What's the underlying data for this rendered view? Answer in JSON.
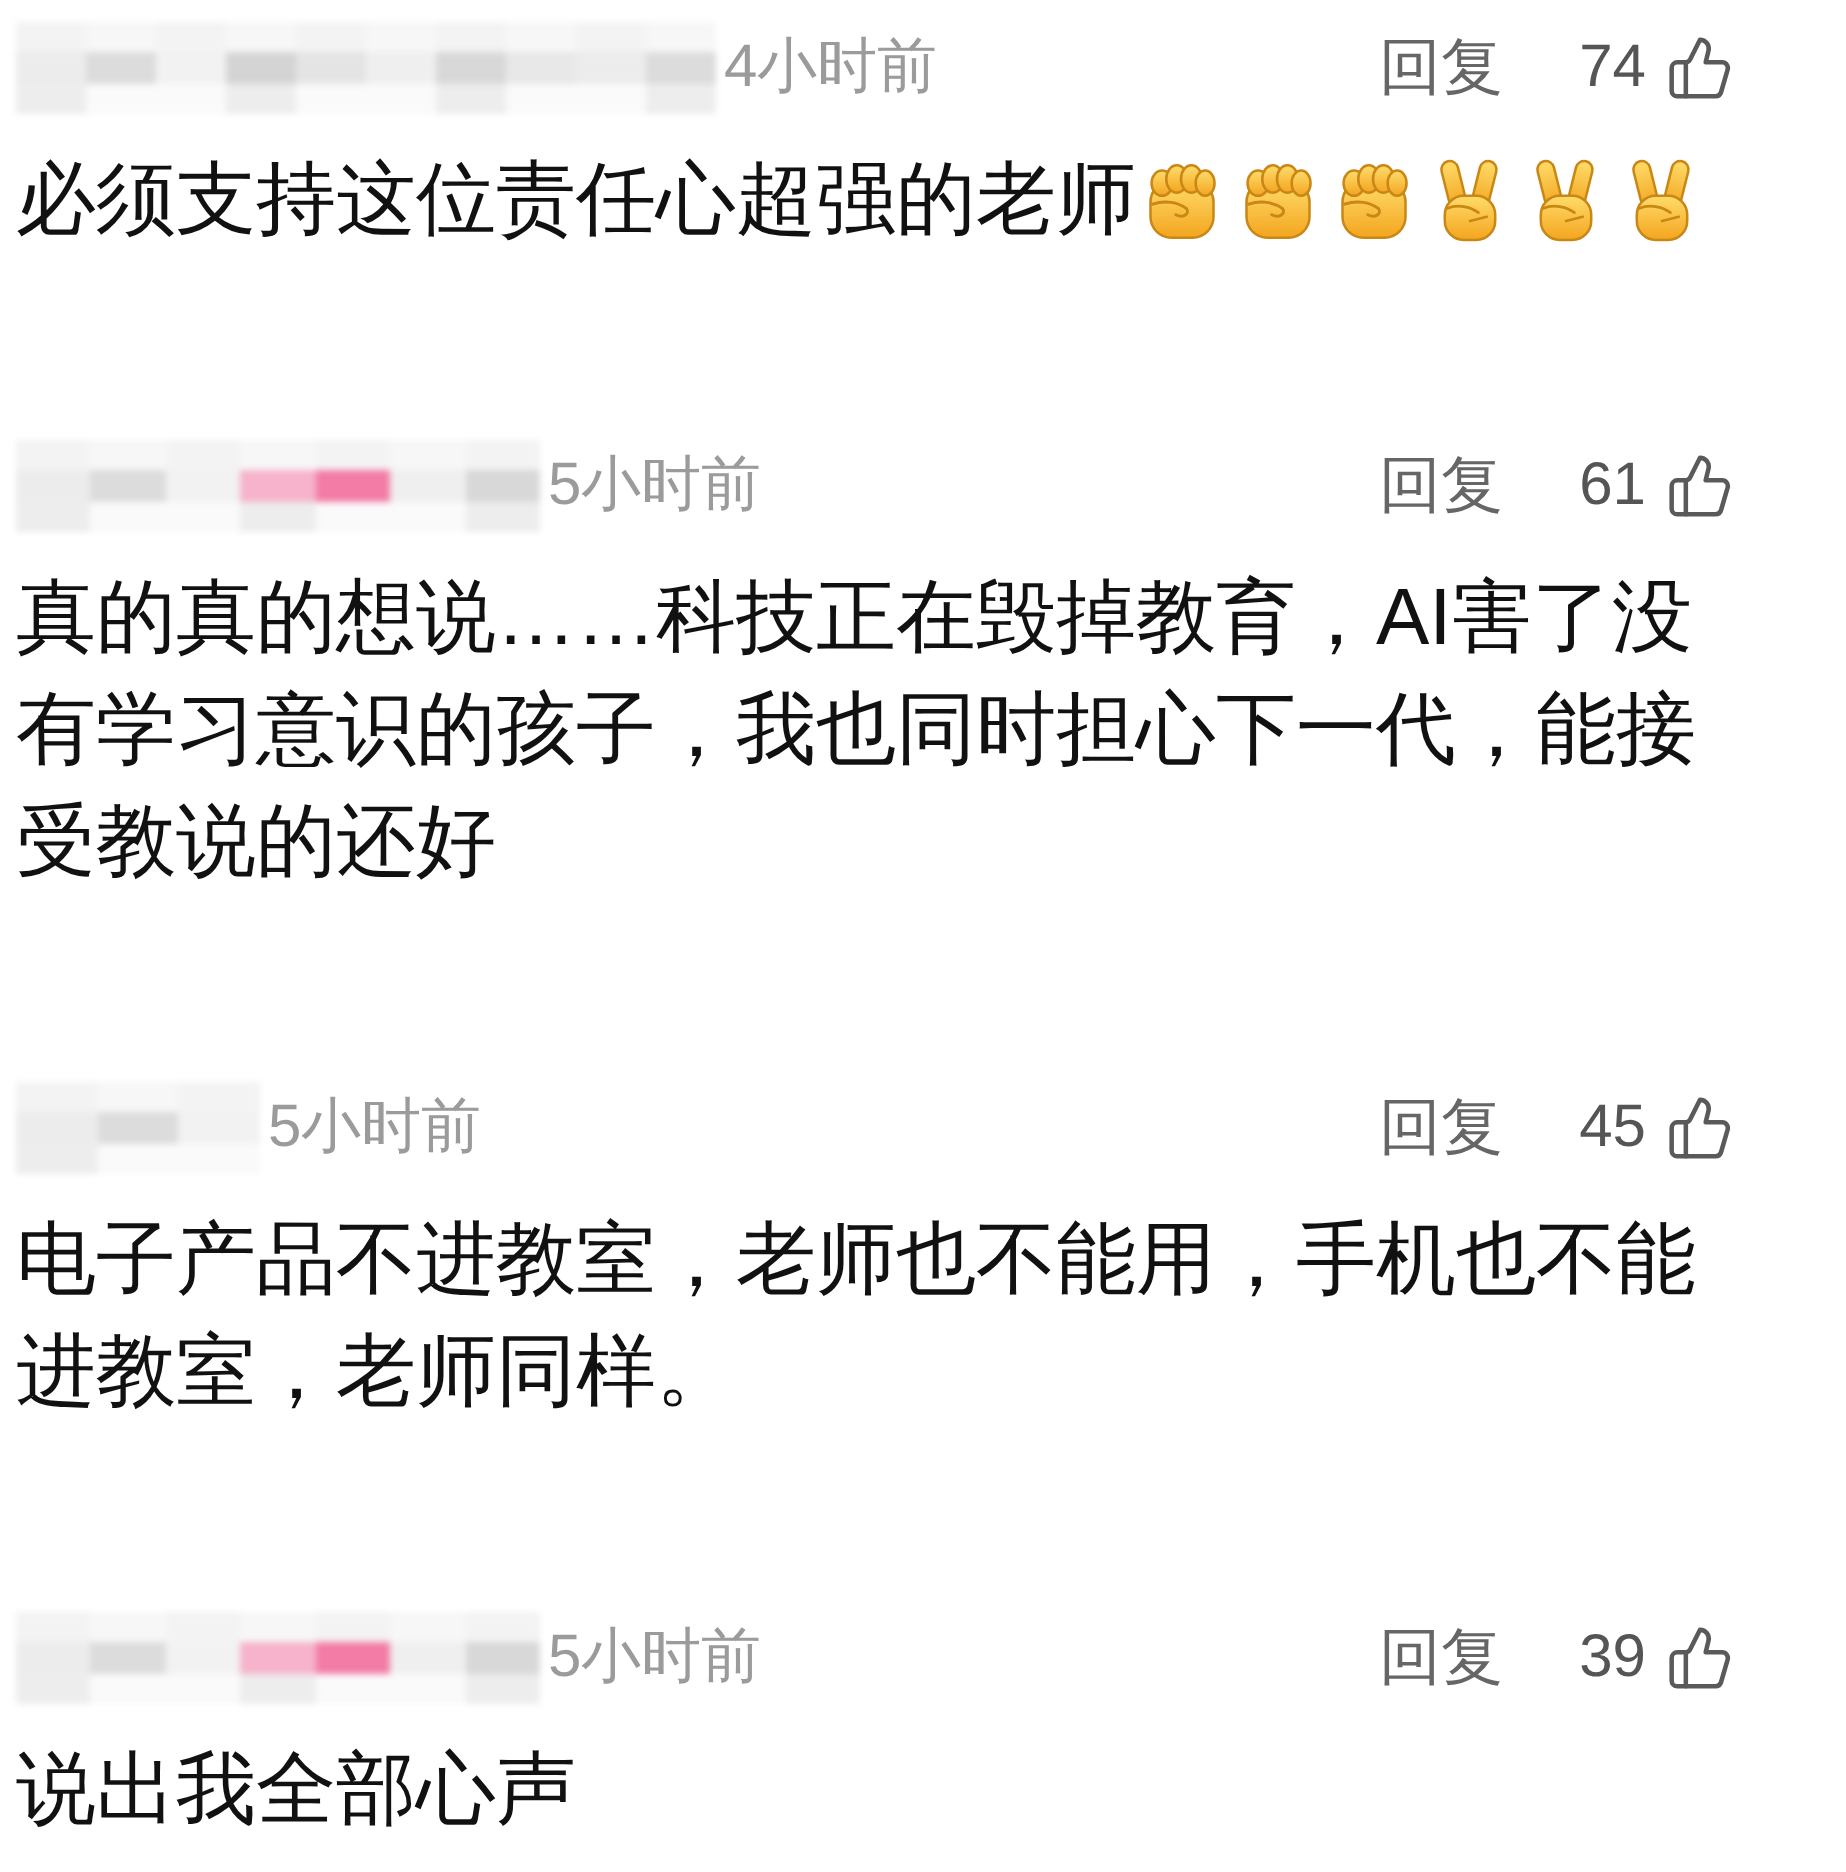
{
  "comments": [
    {
      "name_blur": {
        "tinted": false
      },
      "time": "4小时前",
      "reply": "回复",
      "likes": "74",
      "text": "必须支持这位责任心超强的老师",
      "emojis": [
        {
          "kind": "fist"
        },
        {
          "kind": "fist"
        },
        {
          "kind": "fist"
        },
        {
          "kind": "victory"
        },
        {
          "kind": "victory"
        },
        {
          "kind": "victory"
        }
      ]
    },
    {
      "name_blur": {
        "tinted": true
      },
      "time": "5小时前",
      "reply": "回复",
      "likes": "61",
      "text": "真的真的想说……科技正在毁掉教育，AI害了没有学习意识的孩子，我也同时担心下一代，能接受教说的还好"
    },
    {
      "name_blur": {
        "tinted": false
      },
      "time": "5小时前",
      "reply": "回复",
      "likes": "45",
      "text": "电子产品不进教室，老师也不能用，手机也不能进教室，老师同样。"
    },
    {
      "name_blur": {
        "tinted": true
      },
      "time": "5小时前",
      "reply": "回复",
      "likes": "39",
      "text": "说出我全部心声"
    }
  ]
}
